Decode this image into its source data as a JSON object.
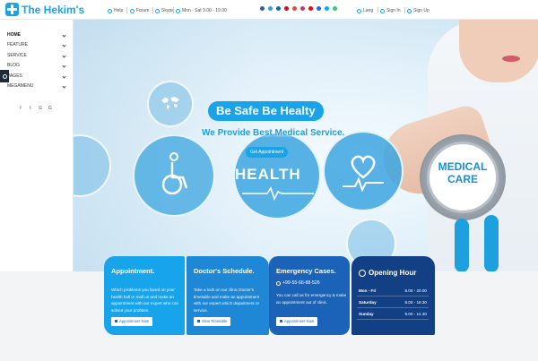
{
  "brand": {
    "name": "The Hekim's",
    "accent": "#1aa3e8"
  },
  "topbar": {
    "help": "Help",
    "forum": "Forum",
    "skype": "Skype",
    "hours": "Mon - Sat 9.00 - 19.00",
    "lang": "Lang",
    "signin": "Sign In",
    "signup": "Sign Up",
    "social_icons": [
      "facebook-icon",
      "twitter-icon",
      "linkedin-icon",
      "pinterest-icon",
      "google-plus-icon",
      "instagram-icon",
      "youtube-icon",
      "behance-icon",
      "skype-icon",
      "whatsapp-icon"
    ]
  },
  "sidebar": {
    "items": [
      {
        "label": "HOME",
        "active": true
      },
      {
        "label": "FEATURE"
      },
      {
        "label": "SERVICE"
      },
      {
        "label": "BLOG"
      },
      {
        "label": "PAGES"
      },
      {
        "label": "MEGAMENU"
      }
    ],
    "social": [
      "f",
      "t",
      "G",
      "G"
    ]
  },
  "hero": {
    "headline": "Be Safe Be Healty",
    "subline": "We Provide Best Medical Service.",
    "button": "Get Appointment",
    "health": "HEALTH",
    "medical_care_line1": "MEDICAL",
    "medical_care_line2": "CARE"
  },
  "cards": {
    "appointment": {
      "title": "Appointment.",
      "text": "Which problems you faced on your health hall or mall us and make an appointment with our expert who can solved your problem.",
      "button": "Appointment Now"
    },
    "schedule": {
      "title": "Doctor's Schedule.",
      "text": "Take a look on our clinic Doctor's timetable and make an appointment with our expert which department or service.",
      "button": "View Timetable"
    },
    "emergency": {
      "title": "Emergency Cases.",
      "phone": "+99-55-66-88-526",
      "text": "You can call us for emergency & make an appointment out of clinic.",
      "button": "Appointment Now"
    },
    "opening": {
      "title": "Opening Hour",
      "rows": [
        {
          "day": "Mon - Fri",
          "time": "8.00 - 20.00"
        },
        {
          "day": "Saturday",
          "time": "8.00 - 18.30"
        },
        {
          "day": "Sunday",
          "time": "9.00 - 14.30"
        }
      ]
    }
  }
}
